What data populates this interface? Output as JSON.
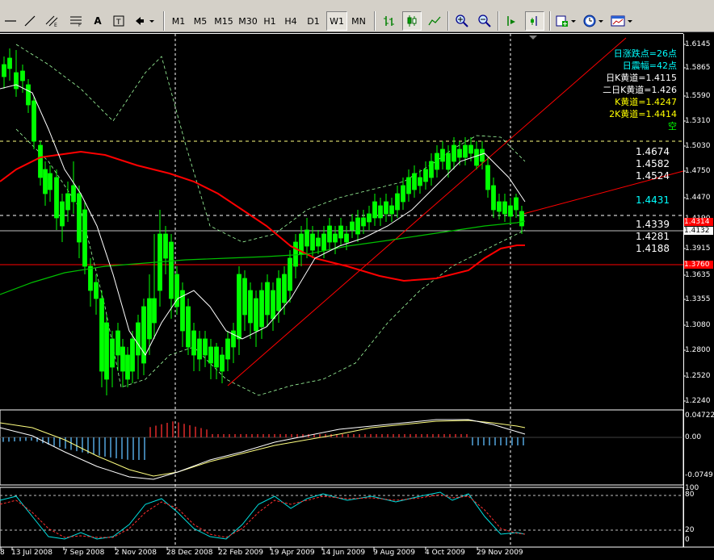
{
  "toolbar": {
    "timeframes": [
      "M1",
      "M5",
      "M15",
      "M30",
      "H1",
      "H4",
      "D1",
      "W1",
      "MN"
    ],
    "active_timeframe": "W1",
    "text_tool": "A"
  },
  "price_axis": {
    "labels": [
      "1.6145",
      "1.5865",
      "1.5590",
      "1.5310",
      "1.5030",
      "1.4750",
      "1.4470",
      "1.4190",
      "1.3915",
      "1.3635",
      "1.3355",
      "1.3080",
      "1.2800",
      "1.2520",
      "1.2240"
    ],
    "current_red": "1.4314",
    "current_white": "1.4132",
    "red_level": "1.3760"
  },
  "info_panel": {
    "lines": [
      {
        "text": "日涨跌点=26点",
        "color": "#00ffff"
      },
      {
        "text": "日震幅=42点",
        "color": "#00ffff"
      },
      {
        "text": "日K黄道=1.4115",
        "color": "#ffffff"
      },
      {
        "text": "二日K黄道=1.426",
        "color": "#ffffff"
      },
      {
        "text": "K黄道=1.4247",
        "color": "#ffff00"
      },
      {
        "text": "2K黄道=1.4414",
        "color": "#ffff00"
      },
      {
        "text": "空",
        "color": "#00ff00"
      }
    ]
  },
  "levels": [
    {
      "text": "1.4674",
      "color": "#ffffff"
    },
    {
      "text": "1.4582",
      "color": "#ffffff"
    },
    {
      "text": "1.4524",
      "color": "#ffffff"
    },
    {
      "text": "1.4431",
      "color": "#00ffff"
    },
    {
      "text": "1.4339",
      "color": "#ffffff"
    },
    {
      "text": "1.4281",
      "color": "#ffffff"
    },
    {
      "text": "1.4188",
      "color": "#ffffff"
    }
  ],
  "macd_axis": {
    "labels": [
      "0.04722",
      "0.00",
      "-0.0749"
    ]
  },
  "stoch_axis": {
    "labels": [
      "100",
      "80",
      "20",
      "0"
    ]
  },
  "time_axis": {
    "labels": [
      "8",
      "13 Jul 2008",
      "7 Sep 2008",
      "2 Nov 2008",
      "28 Dec 2008",
      "22 Feb 2009",
      "19 Apr 2009",
      "14 Jun 2009",
      "9 Aug 2009",
      "4 Oct 2009",
      "29 Nov 2009"
    ]
  },
  "colors": {
    "background": "#000000",
    "bull_candle": "#00ff00",
    "ma_red": "#ff0000",
    "ma_green": "#00c000",
    "ma_white": "#ffffff",
    "toolbar_bg": "#d4d0c8"
  }
}
